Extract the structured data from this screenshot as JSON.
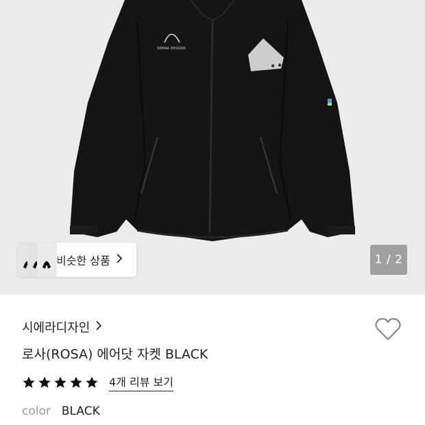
{
  "gallery": {
    "similar_label": "비슷한 상품",
    "counter": "1 / 2"
  },
  "product": {
    "brand": "시에라디자인",
    "title": "로사(ROSA) 에어닷 자켓 BLACK",
    "rating": 5,
    "rating_max": 5,
    "review_link": "4개 리뷰 보기",
    "color_label": "color",
    "color_value": "BLACK"
  },
  "jacket_logo_text": "SIERRA DESIGNS",
  "colors": {
    "background": "#ffffff",
    "photo_bg": "#ececec",
    "jacket": "#141414",
    "star": "#111111",
    "muted": "#999999"
  },
  "icons": {
    "brand_arrow": "chevron-right-icon",
    "similar_arrow": "chevron-right-icon",
    "wishlist": "heart-outline-icon",
    "rating": "star-icon"
  }
}
